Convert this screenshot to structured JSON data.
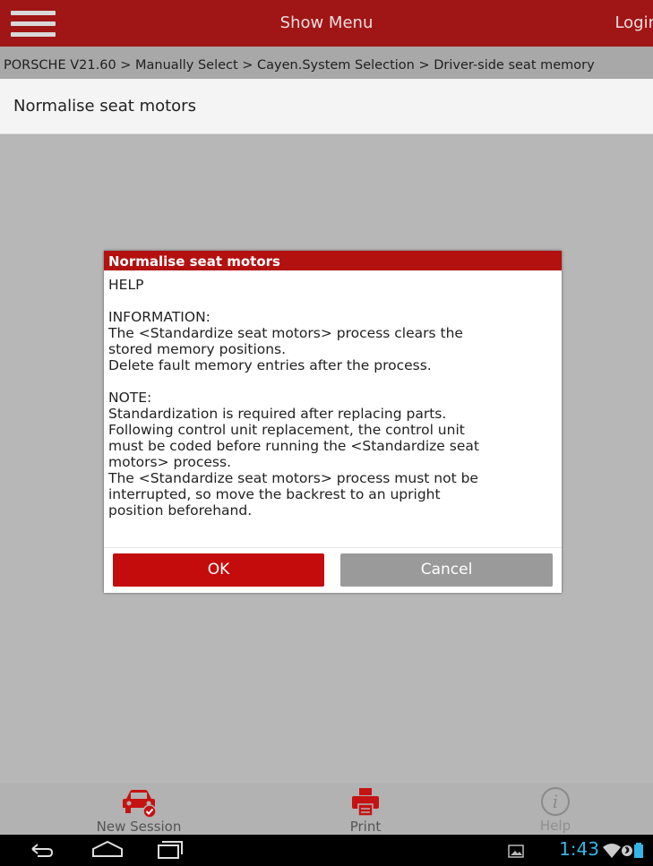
{
  "topbar": {
    "title": "Show Menu",
    "login": "Login"
  },
  "breadcrumb": "PORSCHE V21.60 > Manually Select > Cayen.System Selection > Driver-side seat memory",
  "page_title": "Normalise seat motors",
  "dialog": {
    "title": "Normalise seat motors",
    "lines": [
      "HELP",
      "",
      "INFORMATION:",
      "The <Standardize seat motors> process clears the",
      "stored memory positions.",
      "Delete fault memory entries after the process.",
      "",
      "NOTE:",
      "Standardization is required after replacing parts.",
      "Following control unit replacement, the control unit",
      "must be coded before running the <Standardize seat",
      "motors> process.",
      "The <Standardize seat motors> process must not be",
      "interrupted, so move the backrest to an upright",
      "position beforehand."
    ],
    "ok_label": "OK",
    "cancel_label": "Cancel"
  },
  "bottom_bar": {
    "new_session": "New Session",
    "print": "Print",
    "help": "Help"
  },
  "system_bar": {
    "time": "1:43",
    "icons": [
      "back-icon",
      "home-icon",
      "recent-apps-icon",
      "gallery-icon",
      "wifi-icon",
      "bluetooth-icon",
      "battery-icon"
    ]
  },
  "colors": {
    "brand_red": "#a01616",
    "accent_blue": "#35b5e5"
  }
}
